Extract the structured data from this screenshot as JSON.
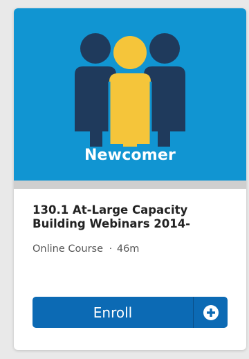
{
  "banner": {
    "label": "Newcomer",
    "background_color": "#1195d2",
    "icon": "people-group-icon"
  },
  "course": {
    "title": "130.1 At-Large Capacity Building Webinars 2014-",
    "type": "Online Course",
    "separator": "·",
    "duration": "46m"
  },
  "enroll": {
    "label": "Enroll",
    "icon": "plus-circle-icon",
    "color": "#0c6ab4"
  }
}
